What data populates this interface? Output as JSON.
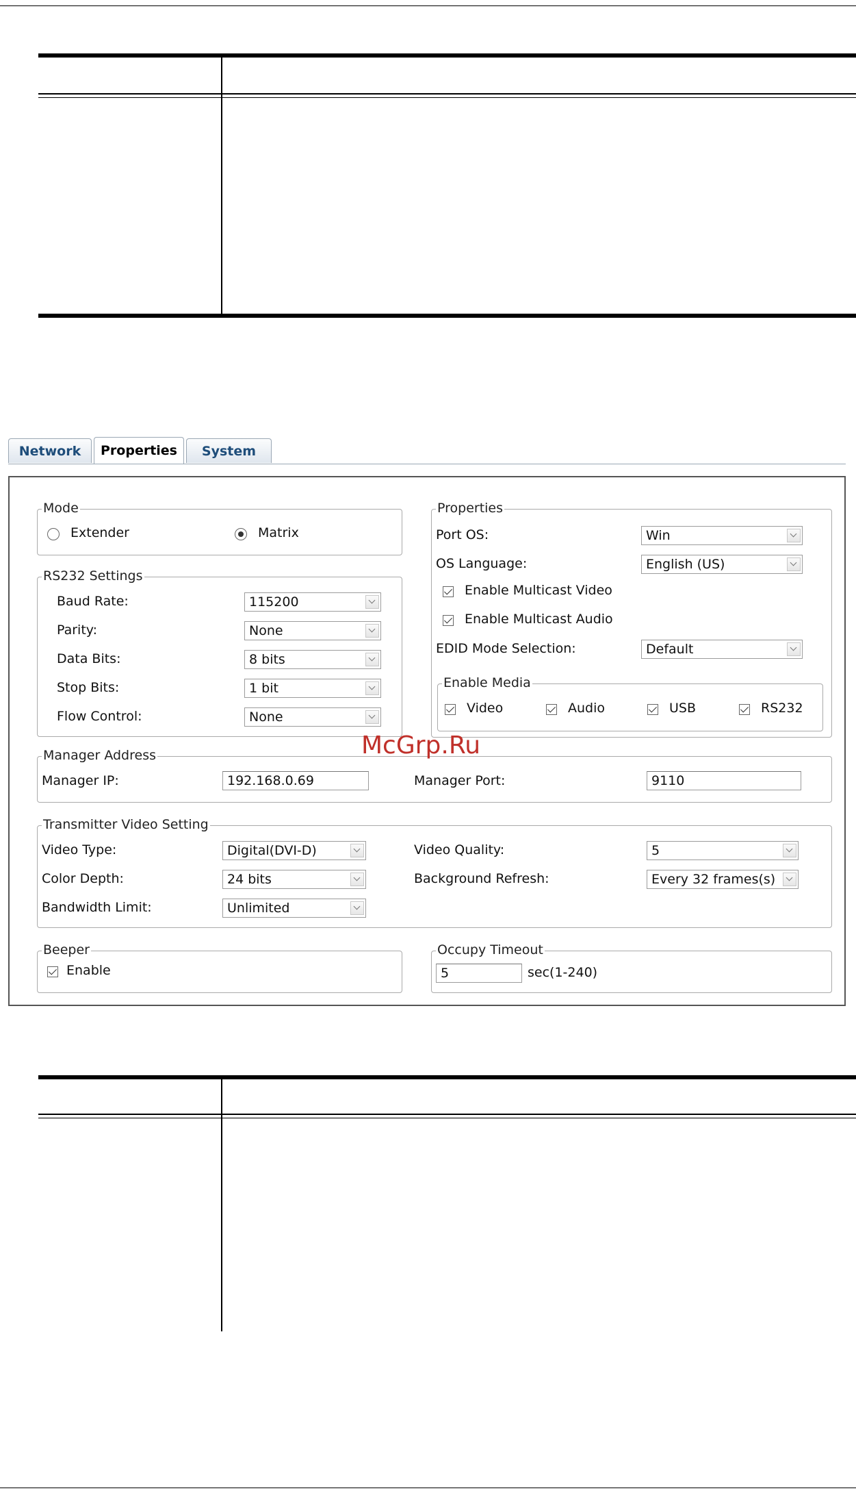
{
  "tabs": [
    "Network",
    "Properties",
    "System"
  ],
  "active_tab": "Properties",
  "mode": {
    "legend": "Mode",
    "options": [
      "Extender",
      "Matrix"
    ],
    "selected": "Matrix"
  },
  "rs232": {
    "legend": "RS232 Settings",
    "fields": [
      {
        "label": "Baud Rate:",
        "value": "115200"
      },
      {
        "label": "Parity:",
        "value": "None"
      },
      {
        "label": "Data Bits:",
        "value": "8 bits"
      },
      {
        "label": "Stop Bits:",
        "value": "1 bit"
      },
      {
        "label": "Flow Control:",
        "value": "None"
      }
    ]
  },
  "properties": {
    "legend": "Properties",
    "port_os_label": "Port OS:",
    "port_os_value": "Win",
    "os_language_label": "OS Language:",
    "os_language_value": "English (US)",
    "multicast_video_label": "Enable Multicast Video",
    "multicast_audio_label": "Enable Multicast Audio",
    "edid_label": "EDID Mode Selection:",
    "edid_value": "Default",
    "enable_media": {
      "legend": "Enable Media",
      "items": [
        "Video",
        "Audio",
        "USB",
        "RS232"
      ]
    }
  },
  "manager_address": {
    "legend": "Manager Address",
    "ip_label": "Manager IP:",
    "ip_value": "192.168.0.69",
    "port_label": "Manager Port:",
    "port_value": "9110"
  },
  "transmitter_video": {
    "legend": "Transmitter Video Setting",
    "video_type_label": "Video Type:",
    "video_type_value": "Digital(DVI-D)",
    "color_depth_label": "Color Depth:",
    "color_depth_value": "24 bits",
    "bandwidth_label": "Bandwidth Limit:",
    "bandwidth_value": "Unlimited",
    "video_quality_label": "Video Quality:",
    "video_quality_value": "5",
    "background_refresh_label": "Background Refresh:",
    "background_refresh_value": "Every 32 frames(s)"
  },
  "beeper": {
    "legend": "Beeper",
    "enable_label": "Enable"
  },
  "occupy_timeout": {
    "legend": "Occupy Timeout",
    "value": "5",
    "unit": "sec(1-240)"
  },
  "watermark": "McGrp.Ru"
}
